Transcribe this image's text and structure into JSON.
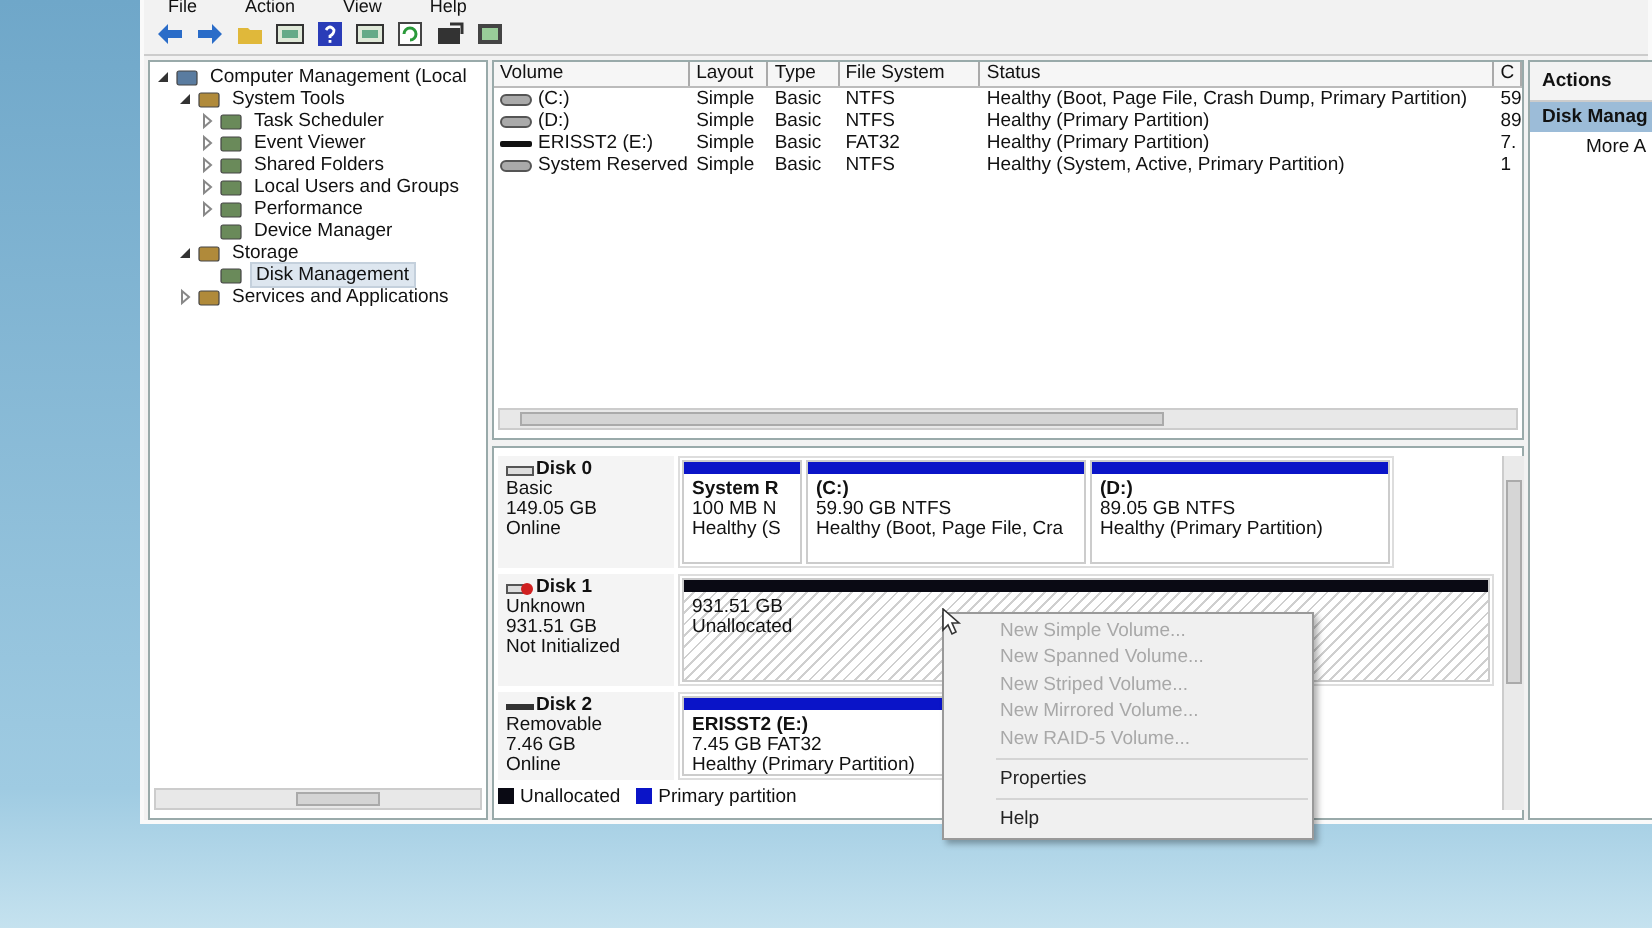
{
  "menu": [
    "File",
    "Action",
    "View",
    "Help"
  ],
  "tree": [
    {
      "label": "Computer Management (Local",
      "expanded": true,
      "selected": false,
      "children": [
        {
          "label": "System Tools",
          "expanded": true,
          "selected": false,
          "children": [
            {
              "label": "Task Scheduler",
              "expanded": false,
              "selected": false
            },
            {
              "label": "Event Viewer",
              "expanded": false,
              "selected": false
            },
            {
              "label": "Shared Folders",
              "expanded": false,
              "selected": false
            },
            {
              "label": "Local Users and Groups",
              "expanded": false,
              "selected": false
            },
            {
              "label": "Performance",
              "expanded": false,
              "selected": false
            },
            {
              "label": "Device Manager",
              "selected": false
            }
          ]
        },
        {
          "label": "Storage",
          "expanded": true,
          "selected": false,
          "children": [
            {
              "label": "Disk Management",
              "selected": true
            }
          ]
        },
        {
          "label": "Services and Applications",
          "expanded": false,
          "selected": false
        }
      ]
    }
  ],
  "table": {
    "columns": [
      "Volume",
      "Layout",
      "Type",
      "File System",
      "Status",
      "C"
    ],
    "rows": [
      {
        "kind": "fixed",
        "cells": [
          "(C:)",
          "Simple",
          "Basic",
          "NTFS",
          "Healthy (Boot, Page File, Crash Dump, Primary Partition)",
          "59"
        ]
      },
      {
        "kind": "fixed",
        "cells": [
          "(D:)",
          "Simple",
          "Basic",
          "NTFS",
          "Healthy (Primary Partition)",
          "89"
        ]
      },
      {
        "kind": "removable",
        "cells": [
          "ERISST2 (E:)",
          "Simple",
          "Basic",
          "FAT32",
          "Healthy (Primary Partition)",
          "7."
        ]
      },
      {
        "kind": "fixed",
        "cells": [
          "System Reserved",
          "Simple",
          "Basic",
          "NTFS",
          "Healthy (System, Active, Primary Partition)",
          "1"
        ]
      }
    ]
  },
  "disks": [
    {
      "name": "Disk 0",
      "kind": "basic",
      "info": [
        "Basic",
        "149.05 GB",
        "Online"
      ],
      "partitions": [
        {
          "kind": "primary",
          "title": "System R",
          "lines": [
            "100 MB N",
            "Healthy (S"
          ]
        },
        {
          "kind": "primary",
          "title": "(C:)",
          "lines": [
            "59.90 GB NTFS",
            "Healthy (Boot, Page File, Cra"
          ]
        },
        {
          "kind": "primary",
          "title": "(D:)",
          "lines": [
            "89.05 GB NTFS",
            "Healthy (Primary Partition)"
          ]
        }
      ]
    },
    {
      "name": "Disk 1",
      "kind": "uninitialized",
      "info": [
        "Unknown",
        "931.51 GB",
        "Not Initialized"
      ],
      "partitions": [
        {
          "kind": "unallocated",
          "lines": [
            "931.51 GB",
            "Unallocated"
          ]
        }
      ]
    },
    {
      "name": "Disk 2",
      "kind": "removable",
      "info": [
        "Removable",
        "7.46 GB",
        "Online"
      ],
      "partitions": [
        {
          "kind": "primary",
          "title": "ERISST2  (E:)",
          "lines": [
            "7.45 GB FAT32",
            "Healthy (Primary Partition)"
          ]
        }
      ]
    }
  ],
  "legend": [
    {
      "kind": "unallocated",
      "label": "Unallocated"
    },
    {
      "kind": "primary",
      "label": "Primary partition"
    }
  ],
  "context_menu": [
    [
      {
        "label": "New Simple Volume...",
        "disabled": true
      },
      {
        "label": "New Spanned Volume...",
        "disabled": true
      },
      {
        "label": "New Striped Volume...",
        "disabled": true
      },
      {
        "label": "New Mirrored Volume...",
        "disabled": true
      },
      {
        "label": "New RAID-5 Volume...",
        "disabled": true
      }
    ],
    [
      {
        "label": "Properties",
        "disabled": false
      }
    ],
    [
      {
        "label": "Help",
        "disabled": false
      }
    ]
  ],
  "actions": {
    "title": "Actions",
    "items": [
      {
        "label": "Disk Manag",
        "selected": true
      },
      {
        "label": "More A",
        "selected": false
      }
    ]
  }
}
